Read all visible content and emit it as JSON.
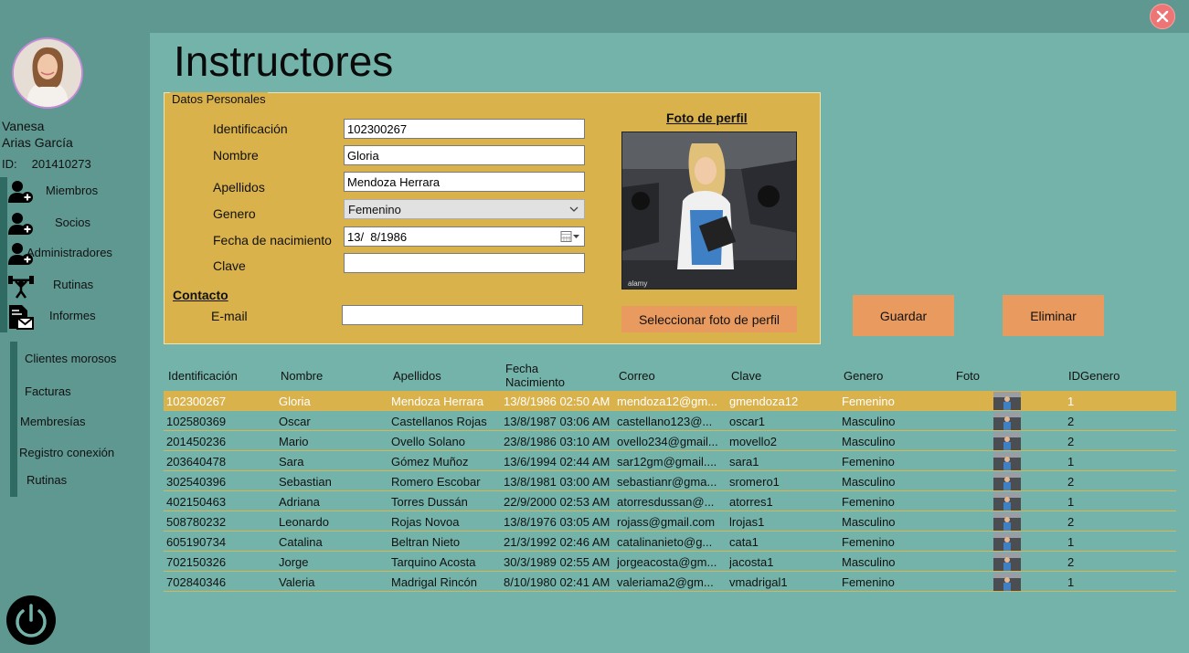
{
  "window": {
    "close_label": "×"
  },
  "sidebar": {
    "user_first_name": "Vanesa",
    "user_last_name": "Arias García",
    "id_label": "ID:",
    "id_value": "201410273",
    "nav": [
      {
        "label": "Miembros",
        "icon": "add-user-icon"
      },
      {
        "label": "Socios",
        "icon": "add-user-icon"
      },
      {
        "label": "Administradores",
        "icon": "add-user-icon"
      },
      {
        "label": "Rutinas",
        "icon": "weightlifter-icon"
      },
      {
        "label": "Informes",
        "icon": "report-icon"
      }
    ],
    "reports": [
      {
        "label": "Clientes morosos"
      },
      {
        "label": "Facturas"
      },
      {
        "label": "Membresías"
      },
      {
        "label": "Registro conexión"
      },
      {
        "label": "Rutinas"
      }
    ]
  },
  "page": {
    "title": "Instructores"
  },
  "form": {
    "legend": "Datos Personales",
    "identificacion_label": "Identificación",
    "identificacion_value": "102300267",
    "nombre_label": "Nombre",
    "nombre_value": "Gloria",
    "apellidos_label": "Apellidos",
    "apellidos_value": "Mendoza Herrara",
    "genero_label": "Genero",
    "genero_value": "Femenino",
    "fecha_label": "Fecha de nacimiento",
    "fecha_value": "13/  8/1986",
    "clave_label": "Clave",
    "clave_value": "",
    "contacto_title": "Contacto",
    "email_label": "E-mail",
    "email_value": "",
    "foto_title": "Foto de perfil",
    "select_photo_label": "Seleccionar foto de perfil"
  },
  "actions": {
    "save_label": "Guardar",
    "delete_label": "Eliminar"
  },
  "colors": {
    "accent": "#dab24c",
    "button": "#e99a5e",
    "main_bg": "#74b3aa",
    "sidebar_bg": "#5e9891"
  },
  "table": {
    "columns": [
      "Identificación",
      "Nombre",
      "Apellidos",
      "Fecha Nacimiento",
      "Correo",
      "Clave",
      "Genero",
      "Foto",
      "IDGenero"
    ],
    "column_fecha_line1": "Fecha",
    "column_fecha_line2": "Nacimiento",
    "rows": [
      {
        "id": "102300267",
        "nombre": "Gloria",
        "apellidos": "Mendoza Herrara",
        "fecha": "13/8/1986 02:50 AM",
        "correo": "mendoza12@gm...",
        "clave": "gmendoza12",
        "genero": "Femenino",
        "idgenero": "1",
        "selected": true
      },
      {
        "id": "102580369",
        "nombre": "Oscar",
        "apellidos": "Castellanos Rojas",
        "fecha": "13/8/1987 03:06 AM",
        "correo": "castellano123@...",
        "clave": "oscar1",
        "genero": "Masculino",
        "idgenero": "2"
      },
      {
        "id": "201450236",
        "nombre": "Mario",
        "apellidos": "Ovello Solano",
        "fecha": "23/8/1986 03:10 AM",
        "correo": "ovello234@gmail...",
        "clave": "movello2",
        "genero": "Masculino",
        "idgenero": "2"
      },
      {
        "id": "203640478",
        "nombre": "Sara",
        "apellidos": "Gómez Muñoz",
        "fecha": "13/6/1994 02:44 AM",
        "correo": "sar12gm@gmail....",
        "clave": "sara1",
        "genero": "Femenino",
        "idgenero": "1"
      },
      {
        "id": "302540396",
        "nombre": "Sebastian",
        "apellidos": "Romero Escobar",
        "fecha": "13/8/1981 03:00 AM",
        "correo": "sebastianr@gma...",
        "clave": "sromero1",
        "genero": "Masculino",
        "idgenero": "2"
      },
      {
        "id": "402150463",
        "nombre": "Adriana",
        "apellidos": "Torres Dussán",
        "fecha": "22/9/2000 02:53 AM",
        "correo": "atorresdussan@...",
        "clave": "atorres1",
        "genero": "Femenino",
        "idgenero": "1"
      },
      {
        "id": "508780232",
        "nombre": "Leonardo",
        "apellidos": "Rojas Novoa",
        "fecha": "13/8/1976 03:05 AM",
        "correo": "rojass@gmail.com",
        "clave": "lrojas1",
        "genero": "Masculino",
        "idgenero": "2"
      },
      {
        "id": "605190734",
        "nombre": "Catalina",
        "apellidos": "Beltran Nieto",
        "fecha": "21/3/1992 02:46 AM",
        "correo": "catalinanieto@g...",
        "clave": "cata1",
        "genero": "Femenino",
        "idgenero": "1"
      },
      {
        "id": "702150326",
        "nombre": "Jorge",
        "apellidos": "Tarquino Acosta",
        "fecha": "30/3/1989 02:55 AM",
        "correo": "jorgeacosta@gm...",
        "clave": "jacosta1",
        "genero": "Masculino",
        "idgenero": "2"
      },
      {
        "id": "702840346",
        "nombre": "Valeria",
        "apellidos": "Madrigal Rincón",
        "fecha": "8/10/1980 02:41 AM",
        "correo": "valeriama2@gm...",
        "clave": "vmadrigal1",
        "genero": "Femenino",
        "idgenero": "1"
      }
    ]
  }
}
